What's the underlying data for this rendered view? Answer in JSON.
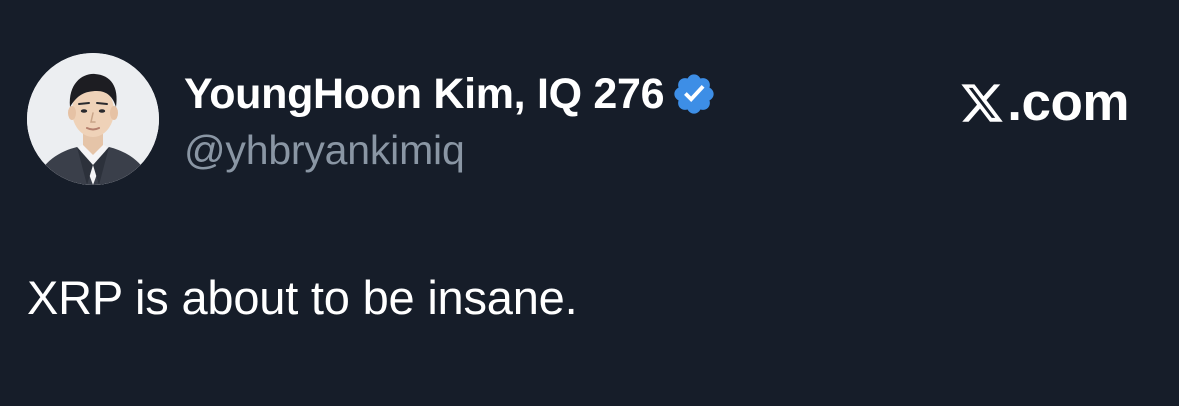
{
  "theme": {
    "background": "#161d29",
    "text_primary": "#ffffff",
    "text_secondary": "#8a96a4",
    "verified_blue": "#3d8ee6"
  },
  "author": {
    "display_name": "YoungHoon Kim, IQ 276",
    "handle": "@yhbryankimiq",
    "verified": true,
    "avatar_icon": "profile-photo",
    "badge_icon": "verified-badge-icon"
  },
  "brand": {
    "logo_icon": "x-logo-icon",
    "text": ".com"
  },
  "tweet": {
    "text": "XRP is about to be insane."
  }
}
